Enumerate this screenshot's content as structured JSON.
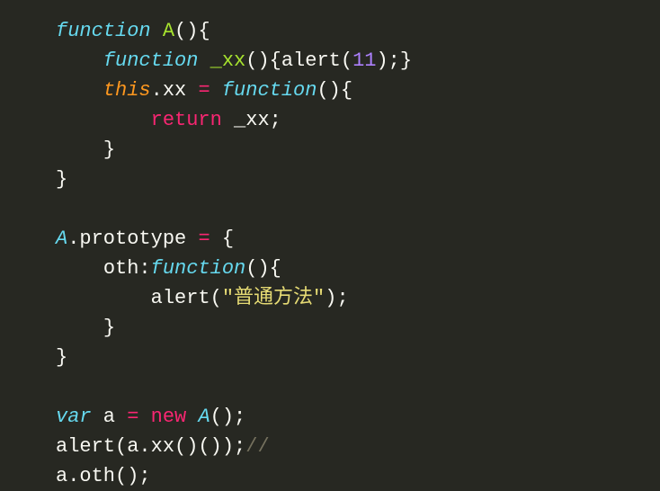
{
  "code": {
    "l1": {
      "kw_function": "function",
      "name": "A",
      "parens": "()",
      "brace_open": "{"
    },
    "l2": {
      "kw_function": "function",
      "name": "_xx",
      "parens": "()",
      "brace_open": "{",
      "call": "alert",
      "lparen": "(",
      "num": "11",
      "rparen_semi": ");",
      "brace_close": "}"
    },
    "l3": {
      "this": "this",
      "dot_xx": ".xx ",
      "eq": "=",
      "sp": " ",
      "kw_function": "function",
      "parens": "()",
      "brace_open": "{"
    },
    "l4": {
      "return": "return",
      "sp": " ",
      "id": "_xx;"
    },
    "l5": {
      "brace_close": "}"
    },
    "l6": {
      "brace_close": "}"
    },
    "l7": {
      "classname": "A",
      "dot_proto": ".prototype ",
      "eq": "=",
      "sp": " ",
      "brace_open": "{"
    },
    "l8": {
      "key": "oth",
      "colon": ":",
      "kw_function": "function",
      "parens": "()",
      "brace_open": "{"
    },
    "l9": {
      "call": "alert",
      "lparen": "(",
      "str": "\"普通方法\"",
      "rparen_semi": ");"
    },
    "l10": {
      "brace_close": "}"
    },
    "l11": {
      "brace_close": "}"
    },
    "l12": {
      "var": "var",
      "sp1": " a ",
      "eq": "=",
      "sp2": " ",
      "new": "new",
      "sp3": " ",
      "ctor": "A",
      "parens_semi": "();"
    },
    "l13": {
      "call": "alert",
      "args": "(a.xx()());",
      "comment": "//"
    },
    "l14": {
      "text": "a.oth();"
    }
  }
}
